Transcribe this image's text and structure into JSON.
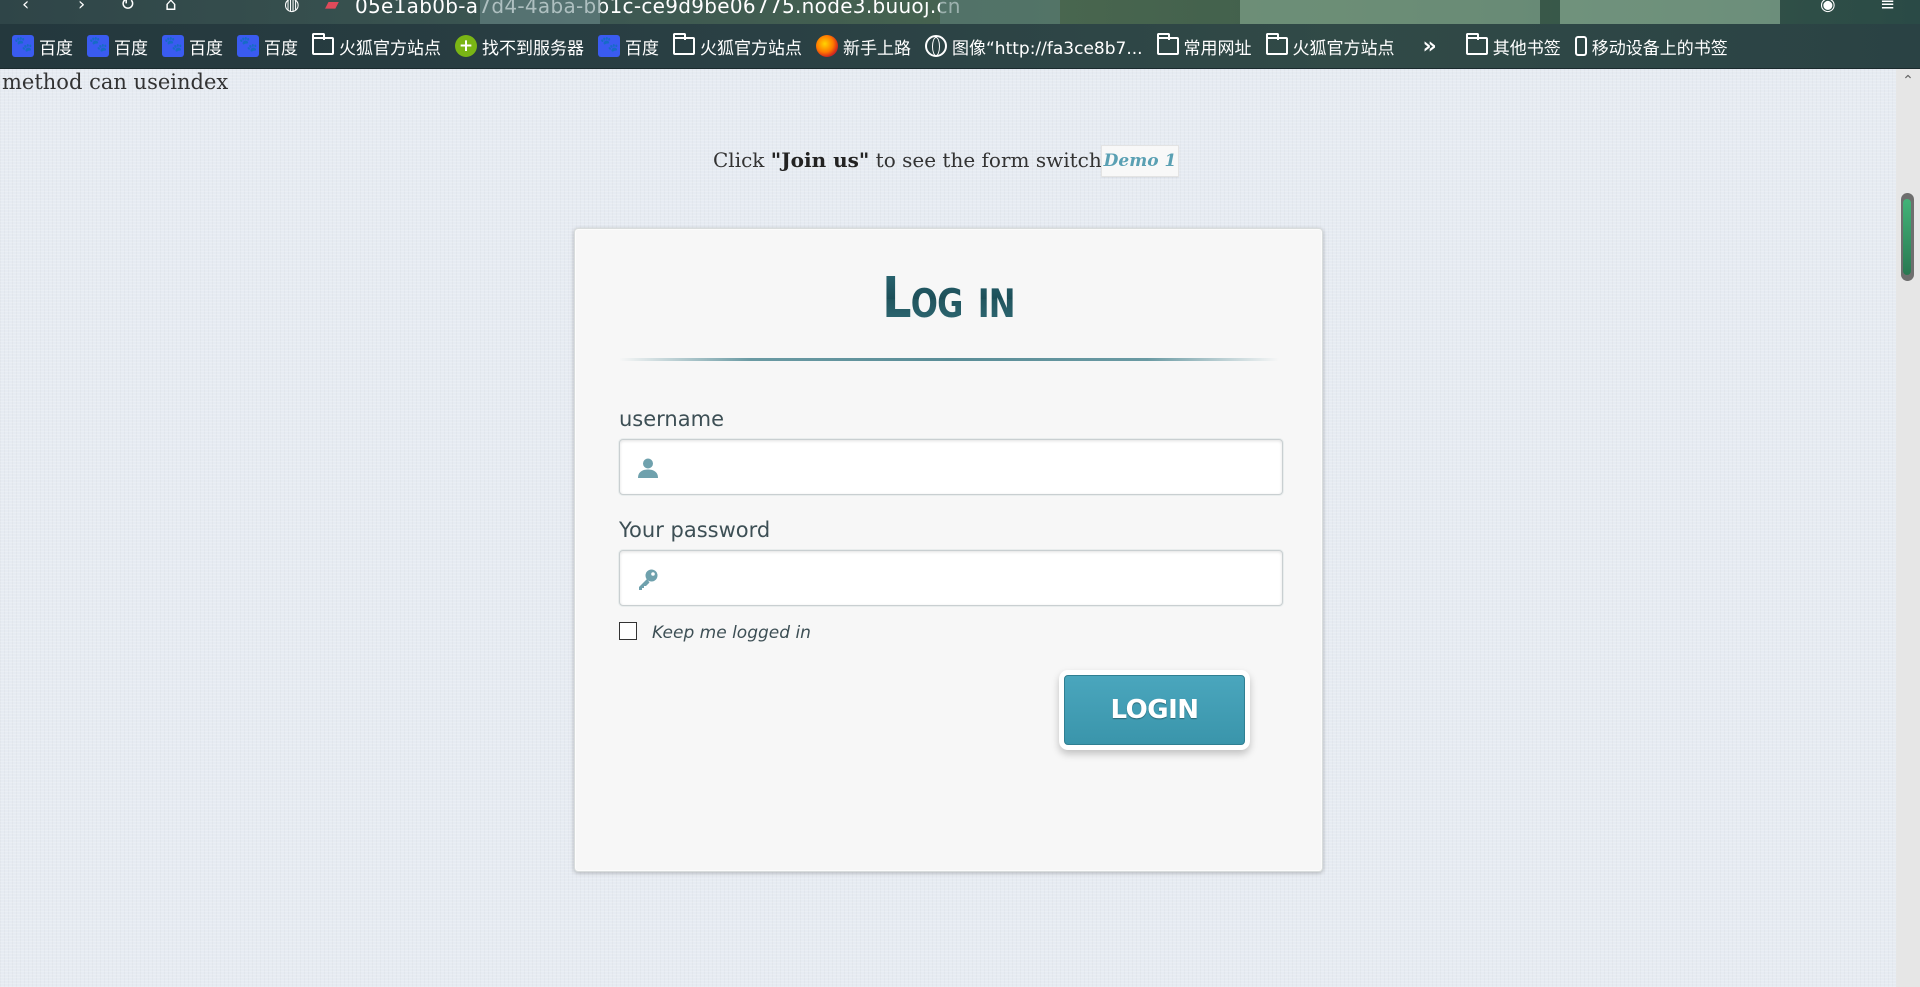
{
  "browser": {
    "url_text": "05e1ab0b-a7d4-4aba-bb1c-ce9d9be06775.node3.buuoj.cn",
    "bookmarks": [
      {
        "label": "百度",
        "icon": "baidu-icon"
      },
      {
        "label": "百度",
        "icon": "baidu-icon"
      },
      {
        "label": "百度",
        "icon": "baidu-icon"
      },
      {
        "label": "百度",
        "icon": "baidu-icon"
      },
      {
        "label": "火狐官方站点",
        "icon": "folder-icon"
      },
      {
        "label": "找不到服务器",
        "icon": "plus-icon"
      },
      {
        "label": "百度",
        "icon": "baidu-icon"
      },
      {
        "label": "火狐官方站点",
        "icon": "folder-icon"
      },
      {
        "label": "新手上路",
        "icon": "firefox-icon"
      },
      {
        "label": "图像“http://fa3ce8b7...",
        "icon": "globe-icon"
      },
      {
        "label": "常用网址",
        "icon": "folder-icon"
      },
      {
        "label": "火狐官方站点",
        "icon": "folder-icon"
      }
    ],
    "other_bookmarks": "其他书签",
    "mobile_bookmarks": "移动设备上的书签"
  },
  "page": {
    "method_note": "method can useindex",
    "hint_prefix": "Click ",
    "hint_bold": "\"Join us\"",
    "hint_suffix": " to see the form switch",
    "demo_tab": "Demo 1"
  },
  "form": {
    "title": "Log in",
    "username_label": "username",
    "username_value": "",
    "password_label": "Your password",
    "password_value": "",
    "keep_logged_label": "Keep me logged in",
    "keep_logged_checked": false,
    "submit_label": "LOGIN"
  },
  "colors": {
    "accent": "#3a95ab",
    "title": "#225c68",
    "background": "#e6ebf2"
  }
}
